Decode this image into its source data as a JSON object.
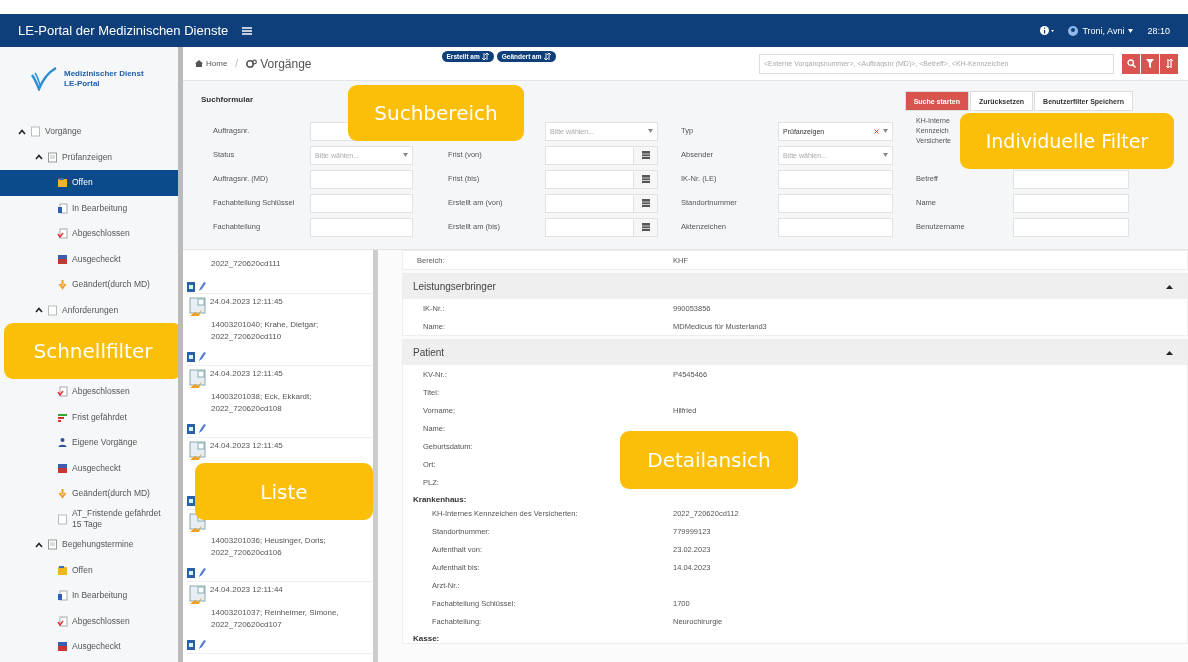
{
  "header": {
    "title": "LE-Portal der Medizinischen Dienste",
    "user": "Troni, Avni",
    "time": "28:10"
  },
  "sidebar": {
    "logo": {
      "line1": "Medizinischer Dienst",
      "line2": "LE-Portal"
    },
    "tree": [
      {
        "label": "Vorgänge",
        "kind": "plain",
        "expanded": true,
        "selected": false,
        "children": [
          {
            "label": "Prüfanzeigen",
            "kind": "folder",
            "expanded": true,
            "selected": false,
            "children": [
              {
                "label": "Offen",
                "kind": "open",
                "selected": true
              },
              {
                "label": "In Bearbeitung",
                "kind": "progress",
                "selected": false
              },
              {
                "label": "Abgeschlossen",
                "kind": "closed",
                "selected": false
              },
              {
                "label": "Ausgecheckt",
                "kind": "checkedout",
                "selected": false
              },
              {
                "label": "Geändert(durch MD)",
                "kind": "changed",
                "selected": false
              }
            ]
          },
          {
            "label": "Anforderungen",
            "kind": "plain",
            "expanded": true,
            "selected": false,
            "callout": "Schnellfilter",
            "children": [
              {
                "label": "Abgeschlossen",
                "kind": "closed",
                "selected": false
              },
              {
                "label": "Frist gefährdet",
                "kind": "deadline",
                "selected": false
              },
              {
                "label": "Eigene Vorgänge",
                "kind": "own",
                "selected": false
              },
              {
                "label": "Ausgecheckt",
                "kind": "checkedout",
                "selected": false
              },
              {
                "label": "Geändert(durch MD)",
                "kind": "changed",
                "selected": false
              },
              {
                "label": "AT_Fristende gefährdet 15 Tage",
                "kind": "plain",
                "selected": false
              }
            ]
          },
          {
            "label": "Begehungstermine",
            "kind": "folder",
            "expanded": true,
            "selected": false,
            "children": [
              {
                "label": "Offen",
                "kind": "open",
                "selected": false
              },
              {
                "label": "In Bearbeitung",
                "kind": "progress",
                "selected": false
              },
              {
                "label": "Abgeschlossen",
                "kind": "closed",
                "selected": false
              },
              {
                "label": "Ausgecheckt",
                "kind": "checkedout",
                "selected": false
              }
            ]
          }
        ]
      }
    ]
  },
  "toolbar": {
    "breadcrumb": [
      "Home",
      "Vorgänge"
    ],
    "separator": "/",
    "sort_buttons": [
      "Erstellt am",
      "Geändert am"
    ],
    "search": {
      "placeholder": "<Externe Vorgangsnummer>, <Auftragsnr (MD)>, <Betreff>, <KH-Kennzeichen"
    }
  },
  "search_form": {
    "title": "Suchformular",
    "callout": "Suchbereich",
    "filter_callout": "Individuelle Filter",
    "buttons": [
      {
        "label": "Suche starten",
        "primary": true
      },
      {
        "label": "Zurücksetzen",
        "primary": false
      },
      {
        "label": "Benutzerfilter Speichern",
        "primary": false
      }
    ],
    "rows": [
      [
        {
          "label": "Auftragsnr.",
          "kind": "text"
        },
        {
          "kind": "select",
          "placeholder": "Bitte wählen..."
        },
        {
          "label": "Typ",
          "kind": "select",
          "value": "Prüfanzeigen"
        },
        {
          "label": "KH-Interne Kennzeich Versicherte",
          "kind": "none"
        }
      ],
      [
        {
          "label": "Status",
          "kind": "select",
          "placeholder": "Bitte wählen..."
        },
        {
          "label": "Frist (von)",
          "kind": "date"
        },
        {
          "label": "Absender",
          "kind": "select",
          "placeholder": "Bitte wählen..."
        },
        {
          "kind": "none"
        }
      ],
      [
        {
          "label": "Auftragsnr. (MD)",
          "kind": "text"
        },
        {
          "label": "Frist (bis)",
          "kind": "date"
        },
        {
          "label": "IK-Nr. (LE)",
          "kind": "text"
        },
        {
          "label": "Betreff",
          "kind": "text"
        }
      ],
      [
        {
          "label": "Fachabteilung Schlüssel",
          "kind": "text"
        },
        {
          "label": "Erstellt am (von)",
          "kind": "date"
        },
        {
          "label": "Standortnummer",
          "kind": "text"
        },
        {
          "label": "Name",
          "kind": "text"
        }
      ],
      [
        {
          "label": "Fachabteilung",
          "kind": "text"
        },
        {
          "label": "Erstellt am (bis)",
          "kind": "date"
        },
        {
          "label": "Aktenzeichen",
          "kind": "text"
        },
        {
          "label": "Benutzername",
          "kind": "text"
        }
      ]
    ]
  },
  "list": {
    "callout": "Liste",
    "entries": [
      {
        "text": "2022_720620cd111"
      },
      {
        "date": "24.04.2023 12:11:45",
        "text": "14003201040; Krahe, Dietgar; 2022_720620cd110"
      },
      {
        "date": "24.04.2023 12:11:45",
        "text": "14003201038; Eck, Ekkardt; 2022_720620cd108"
      },
      {
        "date": "24.04.2023 12:11:45"
      },
      {
        "text": "14003201036; Heusinger, Doris; 2022_720620cd106"
      },
      {
        "date": "24.04.2023 12:11:44",
        "text": "14003201037; Reinheimer, Simone, 2022_720620cd107"
      }
    ]
  },
  "detail": {
    "callout": "Detailansich",
    "top_rows": [
      {
        "label": "Bereich:",
        "value": "KHF"
      }
    ],
    "sections": [
      {
        "title": "Leistungserbringer",
        "expanded": true,
        "rows": [
          {
            "label": "IK-Nr.:",
            "value": "990053856"
          },
          {
            "label": "Name:",
            "value": "MDMedicus für Musterland3"
          }
        ]
      },
      {
        "title": "Patient",
        "expanded": true,
        "rows": [
          {
            "label": "KV-Nr.:",
            "value": "P4545466"
          },
          {
            "label": "Titel:"
          },
          {
            "label": "Vorname:",
            "value": "Hilfried"
          },
          {
            "label": "Name:"
          },
          {
            "label": "Geburtsdatum:"
          },
          {
            "label": "Ort:"
          },
          {
            "label": "PLZ:"
          }
        ],
        "groups": [
          {
            "title": "Krankenhaus:",
            "rows": [
              {
                "label": "KH-Internes Kennzeichen des Versicherten:",
                "value": "2022_720620cd112"
              },
              {
                "label": "Standortnummer:",
                "value": "779999123"
              },
              {
                "label": "Aufenthalt von:",
                "value": "23.02.2023"
              },
              {
                "label": "Aufenthalt bis:",
                "value": "14.04.2023"
              },
              {
                "label": "Arzt-Nr.:"
              },
              {
                "label": "Fachabteilung Schlüssel:",
                "value": "1700"
              },
              {
                "label": "Fachabteilung:",
                "value": "Neurochirurgie"
              }
            ]
          },
          {
            "title": "Kasse:"
          }
        ]
      }
    ]
  }
}
